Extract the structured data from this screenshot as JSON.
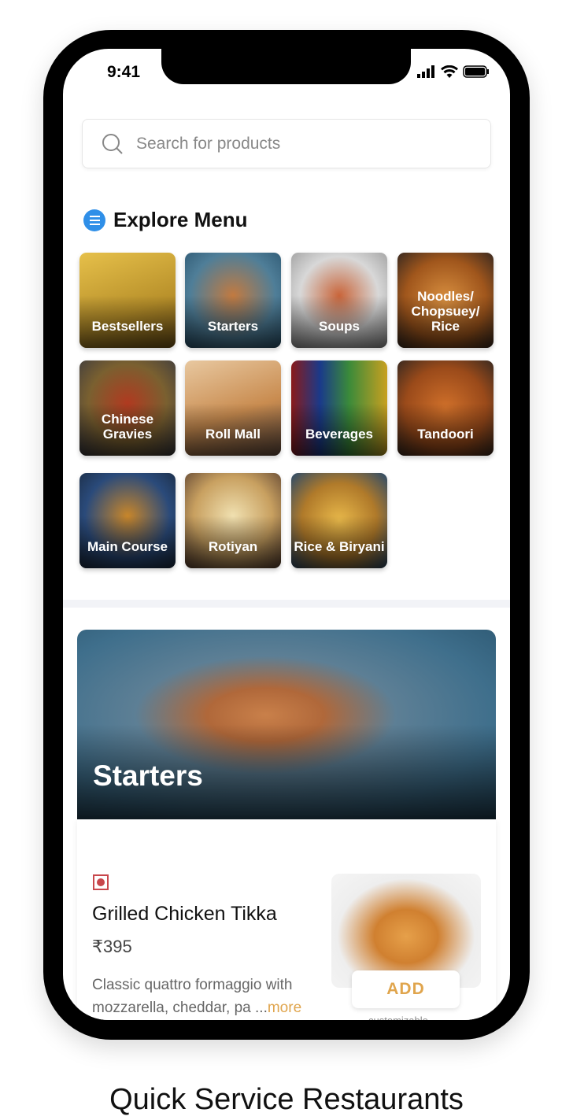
{
  "status_bar": {
    "time": "9:41"
  },
  "search": {
    "placeholder": "Search for products"
  },
  "explore": {
    "title": "Explore Menu",
    "categories": [
      {
        "label": "Bestsellers",
        "bg": "linear-gradient(160deg,#e6c04a,#b8902a 60%,#7a5a18)"
      },
      {
        "label": "Starters",
        "bg": "radial-gradient(circle at 50% 45%,#c27a40,#4f7e98 60%,#2c5670)"
      },
      {
        "label": "Soups",
        "bg": "radial-gradient(circle at 50% 45%,#c9653a,#d8d8d8 55%,#999)"
      },
      {
        "label": "Noodles/ Chopsuey/ Rice",
        "bg": "radial-gradient(circle at 50% 50%,#d99040,#a0561c 60%,#3a2a20)"
      },
      {
        "label": "Chinese Gravies",
        "bg": "radial-gradient(circle at 50% 45%,#b03a20,#7a6030 55%,#3a3a40)"
      },
      {
        "label": "Roll Mall",
        "bg": "linear-gradient(160deg,#e8c8a0,#c98c50 55%,#6a5040)"
      },
      {
        "label": "Beverages",
        "bg": "linear-gradient(90deg,#8a1a1a,#1a3a8a 30%,#3a8a3a 60%,#c8a020)"
      },
      {
        "label": "Tandoori",
        "bg": "radial-gradient(circle at 50% 50%,#d0702a,#9a4a1a 60%,#3a2a20)"
      },
      {
        "label": "Main Course",
        "bg": "radial-gradient(circle at 50% 45%,#c8862a,#2a4a7a 60%,#1a2a40)"
      },
      {
        "label": "Rotiyan",
        "bg": "radial-gradient(circle at 50% 45%,#f0e0b0,#c8a060 55%,#5a4030)"
      },
      {
        "label": "Rice & Biryani",
        "bg": "radial-gradient(circle at 50% 50%,#e8b84a,#b07a2a 55%,#2a4a6a)"
      }
    ]
  },
  "section": {
    "title": "Starters"
  },
  "item": {
    "name": "Grilled Chicken Tikka",
    "price": "₹395",
    "description": "Classic quattro formaggio with mozzarella, cheddar, pa ...",
    "more": "more",
    "add_label": "ADD",
    "note": "customizable",
    "veg_indicator_color": "#c8474c"
  },
  "caption": "Quick Service Restaurants"
}
